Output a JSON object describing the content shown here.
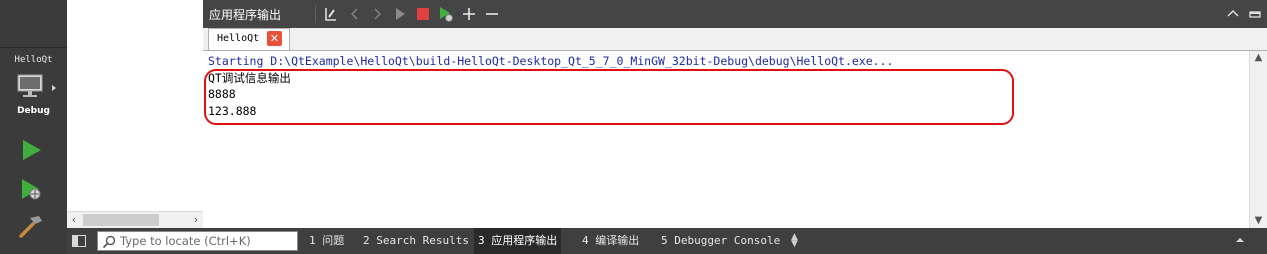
{
  "sidebar": {
    "project_label": "HelloQt",
    "mode_label": "Debug"
  },
  "output_pane": {
    "title": "应用程序输出",
    "tab_label": "HelloQt",
    "tab_close": "✕",
    "lines": [
      "Starting D:\\QtExample\\HelloQt\\build-HelloQt-Desktop_Qt_5_7_0_MinGW_32bit-Debug\\debug\\HelloQt.exe...",
      "QT调试信息输出",
      "8888",
      "123.888"
    ]
  },
  "statusbar": {
    "locator_placeholder": "Type to locate (Ctrl+K)",
    "tabs": [
      {
        "label": "1  问题"
      },
      {
        "label": "2  Search Results"
      },
      {
        "label": "3  应用程序输出",
        "active": true
      },
      {
        "label": "4  编译输出"
      },
      {
        "label": "5  Debugger Console"
      }
    ]
  },
  "colors": {
    "start_line": "#1e2aa8",
    "highlight_border": "#e01010",
    "run_green": "#3fae3f",
    "stop_red": "#e04040"
  },
  "icons": {
    "toolbar": [
      "clear-output-icon",
      "previous-icon",
      "next-icon",
      "run-icon",
      "stop-icon",
      "debug-run-icon",
      "zoom-in-icon",
      "zoom-out-icon",
      "maximize-icon",
      "close-pane-icon"
    ],
    "mode": [
      "monitor-icon",
      "run-icon",
      "debug-run-icon",
      "build-hammer-icon"
    ]
  }
}
